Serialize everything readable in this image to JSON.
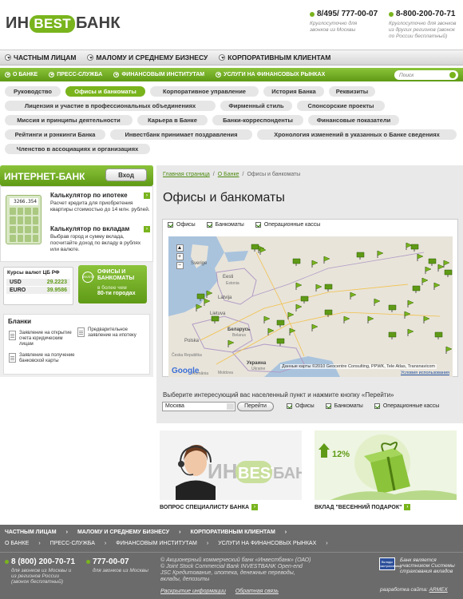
{
  "header": {
    "logo": {
      "part1": "ИН",
      "part2": "BEST",
      "part3": "БАНК"
    },
    "phone1": {
      "number": "8/495/ 777-00-07",
      "sub": "Круглосуточно для звонков из Москвы"
    },
    "phone2": {
      "number": "8-800-200-70-71",
      "sub": "Круглосуточно для звонков из других регионов (звонок по России бесплатный)"
    }
  },
  "topnav": [
    "ЧАСТНЫМ ЛИЦАМ",
    "МАЛОМУ И СРЕДНЕМУ БИЗНЕСУ",
    "КОРПОРАТИВНЫМ КЛИЕНТАМ"
  ],
  "greennav": [
    "О БАНКЕ",
    "ПРЕСС-СЛУЖБА",
    "ФИНАНСОВЫМ ИНСТИТУТАМ",
    "УСЛУГИ НА ФИНАНСОВЫХ РЫНКАХ"
  ],
  "search": {
    "placeholder": "Поиск"
  },
  "pills": [
    {
      "label": "Руководство",
      "active": false
    },
    {
      "label": "Офисы и банкоматы",
      "active": true
    },
    {
      "label": "Корпоративное управление",
      "active": false
    },
    {
      "label": "История Банка",
      "active": false
    },
    {
      "label": "Реквизиты",
      "active": false
    },
    {
      "label": "Лицензия и участие в профессиональных объединениях",
      "active": false
    },
    {
      "label": "Фирменный стиль",
      "active": false
    },
    {
      "label": "Спонсорские проекты",
      "active": false
    },
    {
      "label": "Миссия и принципы деятельности",
      "active": false
    },
    {
      "label": "Карьера в Банке",
      "active": false
    },
    {
      "label": "Банки-корреспонденты",
      "active": false
    },
    {
      "label": "Финансовые показатели",
      "active": false
    },
    {
      "label": "Рейтинги и рэнкинги Банка",
      "active": false
    },
    {
      "label": "Инвестбанк принимает поздравления",
      "active": false
    },
    {
      "label": "Хронология изменений в указанных о Банке сведениях",
      "active": false
    },
    {
      "label": "Членство в ассоциациях и организациях",
      "active": false
    }
  ],
  "internet_bank": {
    "title": "ИНТЕРНЕТ-БАНК",
    "button": "Вход"
  },
  "calculators": {
    "display": "3266.354",
    "mortgage": {
      "title": "Калькулятор по ипотеке",
      "desc": "Расчет кредита для приобретения квартиры стоимостью до 14 млн. рублей."
    },
    "deposit": {
      "title": "Калькулятор по вкладам",
      "desc": "Выбрав город и сумму вклада, посчитайте доход по вкладу в рублях или валюте."
    }
  },
  "rates": {
    "title": "Курсы валют ЦБ РФ",
    "usd_label": "USD",
    "usd": "29.2223",
    "eur_label": "EURO",
    "eur": "39.9586"
  },
  "offices_box": {
    "circle": "INVEST",
    "title": "ОФИСЫ И БАНКОМАТЫ",
    "sub1": "в более чем",
    "sub2": "80-ти городах"
  },
  "blanks": {
    "title": "Бланки",
    "doc1": "Заявление на открытие счета юридическим лицам",
    "doc2": "Предварительное заявление на ипотеку",
    "doc3": "Заявление на получение банковской карты"
  },
  "breadcrumbs": {
    "home": "Главная страница",
    "about": "О Банке",
    "current": "Офисы и банкоматы"
  },
  "page_title": "Офисы и банкоматы",
  "map": {
    "filters": [
      "Офисы",
      "Банкоматы",
      "Операционные кассы"
    ],
    "copyright": "Данные карты ©2010 Geocentre Consulting, PPWK, Tele Atlas, Transnavicom",
    "terms": "Условия использования",
    "google": "Google",
    "labels": {
      "sweden": "Sverige",
      "estonia": "Eesti",
      "latvia": "Latvija",
      "lietuva": "Lietuva",
      "belarus": "Беларусь",
      "polska": "Polska",
      "ukraine": "Украина",
      "estonia_ru": "Estonia",
      "belarus_en": "Belarus",
      "ukraine_en": "Ukraine",
      "moldova": "Moldova",
      "romania": "România",
      "ceska": "Česka Republika"
    }
  },
  "selector": {
    "prompt": "Выберите интересующий вас населенный пункт и нажмите кнопку «Перейти»",
    "city": "Москва",
    "go": "Перейти"
  },
  "bottom_filters": [
    "Офисы",
    "Банкоматы",
    "Операционные кассы"
  ],
  "promos": {
    "specialist": {
      "label": "ВОПРОС СПЕЦИАЛИСТУ БАНКА",
      "logo1": "ИН",
      "logo2": "BEST",
      "logo3": "БАНК"
    },
    "gift": {
      "label": "ВКЛАД \"ВЕСЕННИЙ ПОДАРОК\"",
      "percent": "12%"
    }
  },
  "footer": {
    "nav1": [
      "ЧАСТНЫМ ЛИЦАМ",
      "МАЛОМУ И СРЕДНЕМУ БИЗНЕСУ",
      "КОРПОРАТИВНЫМ КЛИЕНТАМ"
    ],
    "nav2": [
      "О БАНКЕ",
      "ПРЕСС-СЛУЖБА",
      "ФИНАНСОВЫМ ИНСТИТУТАМ",
      "УСЛУГИ НА ФИНАНСОВЫХ РЫНКАХ"
    ],
    "phone1": {
      "number": "8 (800) 200-70-71",
      "sub": "для звонков из Москвы и из регионов России (звонок бесплатный)"
    },
    "phone2": {
      "number": "777-00-07",
      "sub": "для звонков из Москвы"
    },
    "copyright": "© Акционерный коммерческий банк «Инвестбанк» (ОАО) © Joint Stock Commercial Bank INVESTBANK Open-end JSC Кредитование, ипотека, денежные переводы, вклады, депозиты",
    "link1": "Раскрытие информации",
    "link2": "Обратная связь",
    "badge": "Вклады застрахованы",
    "insurance": "Банк является участником Системы страхования вкладов",
    "dev_prefix": "разработка сайта:",
    "dev_name": "ARMEX"
  },
  "colors": {
    "accent": "#79b41d",
    "accent_dark": "#5f9a16",
    "footer": "#6b6b6b"
  }
}
